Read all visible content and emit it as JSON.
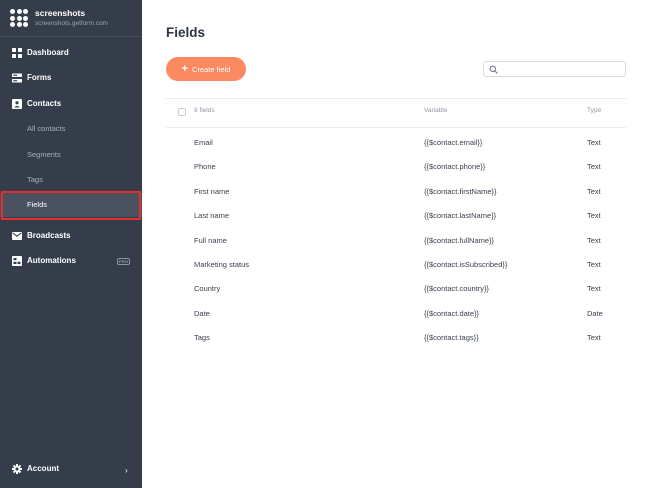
{
  "brand": {
    "name": "screenshots",
    "subdomain": "screenshots.getform.com"
  },
  "nav": {
    "dashboard": "Dashboard",
    "forms": "Forms",
    "contacts": "Contacts",
    "all_contacts": "All contacts",
    "segments": "Segments",
    "tags": "Tags",
    "fields": "Fields",
    "broadcasts": "Broadcasts",
    "automations": "Automations",
    "pro_badge": "PRO",
    "account": "Account"
  },
  "page": {
    "title": "Fields",
    "create_button": "Create field",
    "search_placeholder": ""
  },
  "table": {
    "count_label": "9 fields",
    "col_variable": "Variable",
    "col_type": "Type",
    "rows": [
      {
        "name": "Email",
        "variable": "{{$contact.email}}",
        "type": "Text"
      },
      {
        "name": "Phone",
        "variable": "{{$contact.phone}}",
        "type": "Text"
      },
      {
        "name": "First name",
        "variable": "{{$contact.firstName}}",
        "type": "Text"
      },
      {
        "name": "Last name",
        "variable": "{{$contact.lastName}}",
        "type": "Text"
      },
      {
        "name": "Full name",
        "variable": "{{$contact.fullName}}",
        "type": "Text"
      },
      {
        "name": "Marketing status",
        "variable": "{{$contact.isSubscribed}}",
        "type": "Text"
      },
      {
        "name": "Country",
        "variable": "{{$contact.country}}",
        "type": "Text"
      },
      {
        "name": "Date",
        "variable": "{{$contact.date}}",
        "type": "Date"
      },
      {
        "name": "Tags",
        "variable": "{{$contact.tags}}",
        "type": "Text"
      }
    ]
  },
  "colors": {
    "sidebar": "#353d4b",
    "accent": "#fb8a60",
    "highlight": "#e0302a"
  },
  "icons": [
    "dashboard-icon",
    "forms-icon",
    "contacts-icon",
    "broadcasts-icon",
    "automations-icon",
    "gear-icon",
    "chevron-right-icon",
    "search-icon",
    "plus-icon"
  ]
}
